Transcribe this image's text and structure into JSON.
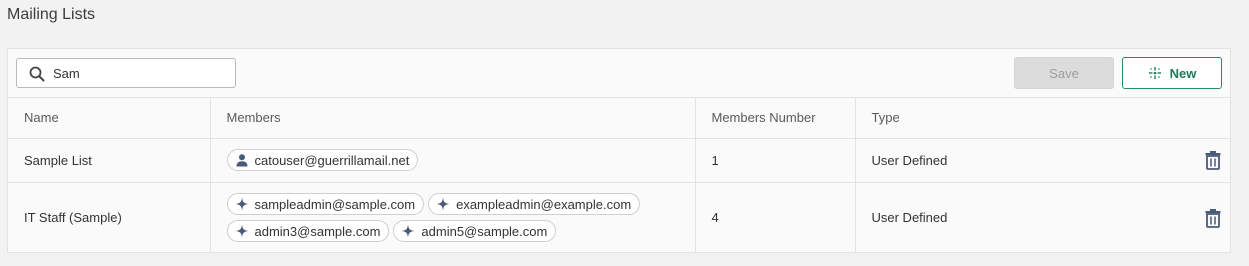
{
  "page": {
    "title": "Mailing Lists"
  },
  "toolbar": {
    "search_value": "Sam",
    "save_label": "Save",
    "new_label": "New"
  },
  "table": {
    "headers": [
      "Name",
      "Members",
      "Members Number",
      "Type"
    ],
    "rows": [
      {
        "name": "Sample List",
        "members": [
          {
            "label": "catouser@guerrillamail.net",
            "icon": "person-icon"
          }
        ],
        "members_number": "1",
        "type": "User Defined"
      },
      {
        "name": "IT Staff (Sample)",
        "members": [
          {
            "label": "sampleadmin@sample.com",
            "icon": "sparkle-icon"
          },
          {
            "label": "exampleadmin@example.com",
            "icon": "sparkle-icon"
          },
          {
            "label": "admin3@sample.com",
            "icon": "sparkle-icon"
          },
          {
            "label": "admin5@sample.com",
            "icon": "sparkle-icon"
          }
        ],
        "members_number": "4",
        "type": "User Defined"
      }
    ]
  },
  "colors": {
    "accent_green": "#1f7a55",
    "icon_slate": "#4a5a78",
    "save_disabled_bg": "#dcdcdc"
  }
}
